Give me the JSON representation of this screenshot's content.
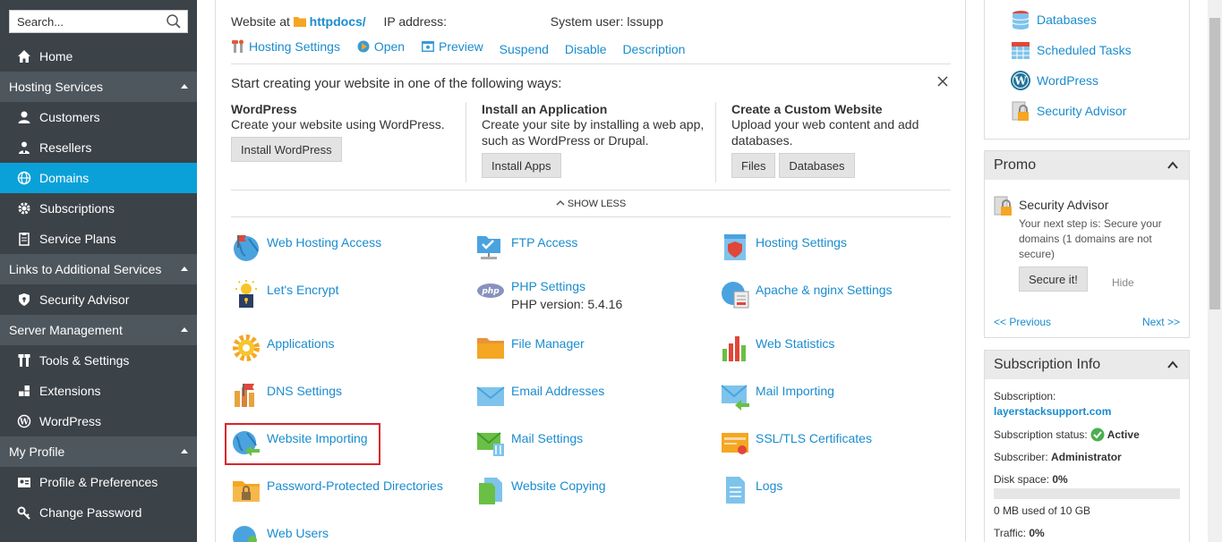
{
  "search": {
    "placeholder": "Search..."
  },
  "nav": {
    "home": "Home",
    "hosting_services": "Hosting Services",
    "customers": "Customers",
    "resellers": "Resellers",
    "domains": "Domains",
    "subscriptions": "Subscriptions",
    "service_plans": "Service Plans",
    "links_additional": "Links to Additional Services",
    "security_advisor": "Security Advisor",
    "server_management": "Server Management",
    "tools_settings": "Tools & Settings",
    "extensions": "Extensions",
    "wordpress": "WordPress",
    "my_profile": "My Profile",
    "profile_prefs": "Profile & Preferences",
    "change_password": "Change Password"
  },
  "site": {
    "website_at": "Website at",
    "folder": "httpdocs/",
    "ip_label": "IP address:",
    "user_label": "System user:",
    "user": "lssupp"
  },
  "actions": {
    "hosting_settings": "Hosting Settings",
    "open": "Open",
    "preview": "Preview",
    "suspend": "Suspend",
    "disable": "Disable",
    "description": "Description"
  },
  "start": {
    "title": "Start creating your website in one of the following ways:",
    "wp_title": "WordPress",
    "wp_desc": "Create your website using WordPress.",
    "wp_button": "Install WordPress",
    "app_title": "Install an Application",
    "app_desc1": "Create your site by installing a web app,",
    "app_desc2": "such as WordPress or Drupal.",
    "app_button": "Install Apps",
    "custom_title": "Create a Custom Website",
    "custom_desc1": "Upload your web content and add",
    "custom_desc2": "databases.",
    "files_button": "Files",
    "db_button": "Databases",
    "show_less": "SHOW LESS"
  },
  "tools": {
    "web_hosting_access": "Web Hosting Access",
    "ftp_access": "FTP Access",
    "hosting_settings": "Hosting Settings",
    "lets_encrypt": "Let's Encrypt",
    "php_settings": "PHP Settings",
    "php_version": "PHP version: 5.4.16",
    "apache_nginx": "Apache & nginx Settings",
    "applications": "Applications",
    "file_manager": "File Manager",
    "web_statistics": "Web Statistics",
    "dns_settings": "DNS Settings",
    "email_addresses": "Email Addresses",
    "mail_importing": "Mail Importing",
    "website_importing": "Website Importing",
    "mail_settings": "Mail Settings",
    "ssl_tls": "SSL/TLS Certificates",
    "password_dirs": "Password-Protected Directories",
    "website_copying": "Website Copying",
    "logs": "Logs",
    "web_users": "Web Users"
  },
  "right": {
    "databases": "Databases",
    "scheduled_tasks": "Scheduled Tasks",
    "wordpress": "WordPress",
    "security_advisor": "Security Advisor",
    "promo_title": "Promo",
    "promo_heading": "Security Advisor",
    "promo_text1": "Your next step is: Secure your",
    "promo_text2": "domains (1 domains are not",
    "promo_text3": "secure)",
    "secure_button": "Secure it!",
    "hide": "Hide",
    "previous": "<< Previous",
    "next": "Next >>",
    "sub_info_title": "Subscription Info",
    "subscription_label": "Subscription:",
    "subscription_value": "layerstacksupport.com",
    "status_label": "Subscription status:",
    "status_value": "Active",
    "subscriber_label": "Subscriber:",
    "subscriber_value": "Administrator",
    "disk_label": "Disk space:",
    "disk_value": "0%",
    "disk_used": "0 MB used of 10 GB",
    "traffic_label": "Traffic:",
    "traffic_value": "0%"
  },
  "colors": {
    "accent": "#0aa1d8",
    "link": "#1a8ccf",
    "sidebar": "#3b4248",
    "highlight": "#d9232d"
  }
}
